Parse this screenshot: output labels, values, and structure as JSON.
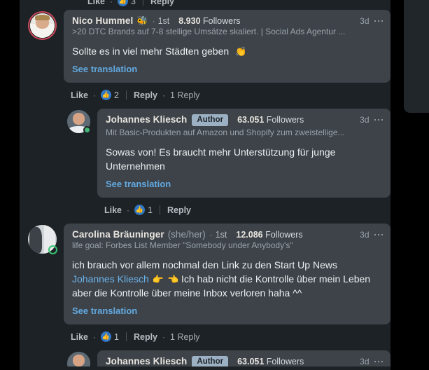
{
  "window": {
    "background": "#1d2226",
    "bubble_color": "#3d4349",
    "link_color": "#63a9e0",
    "accent_badge_color": "#9cb0c4"
  },
  "partial_top_actions": {
    "like_label": "Like",
    "separator": "·",
    "reaction_count": "3",
    "reply_label": "Reply"
  },
  "comments": [
    {
      "id": "comment-nico-hummel",
      "author": "Nico Hummel",
      "name_emoji": "🐝",
      "degree_dot": "·",
      "degree": "1st",
      "followers_count": "8.930",
      "followers_label": "Followers",
      "headline": ">20 DTC Brands auf 7-8 stellige Umsätze skaliert. | Social Ads Agentur ...",
      "timestamp": "3d",
      "body": "Sollte es in viel mehr Städten geben ",
      "body_emoji": "👏",
      "see_translation": "See translation",
      "actions": {
        "like_label": "Like",
        "separator": "·",
        "reaction_count": "2",
        "reply_label": "Reply",
        "reply_count": "1 Reply"
      }
    },
    {
      "id": "comment-johannes-kliesch-reply",
      "author": "Johannes Kliesch",
      "badge": "Author",
      "followers_count": "63.051",
      "followers_label": "Followers",
      "headline": "Mit Basic-Produkten auf Amazon und Shopify zum zweistellige...",
      "timestamp": "3d",
      "body": "Sowas von! Es braucht mehr Unterstützung für junge Unternehmen",
      "see_translation": "See translation",
      "actions": {
        "like_label": "Like",
        "separator": "·",
        "reaction_count": "1",
        "reply_label": "Reply"
      }
    },
    {
      "id": "comment-carolina-brauninger",
      "author": "Carolina Bräuninger",
      "pronouns": "(she/her)",
      "degree_dot": "·",
      "degree": "1st",
      "followers_count": "12.086",
      "followers_label": "Followers",
      "headline": "life goal: Forbes List Member \"Somebody under Anybody's\"",
      "timestamp": "3d",
      "body_line_1": "ich brauch vor allem nochmal den Link zu den Start Up News ",
      "mention": "Johannes Kliesch",
      "body_emoji_1": "👉",
      "body_emoji_2": "👈",
      "body_line_2": " Ich hab nicht die Kontrolle über mein Leben aber die Kontrolle über meine Inbox verloren haha ^^",
      "see_translation": "See translation",
      "actions": {
        "like_label": "Like",
        "separator": "·",
        "reaction_count": "1",
        "reply_label": "Reply",
        "reply_count": "1 Reply"
      }
    }
  ],
  "partial_bottom_comment": {
    "author": "Johannes Kliesch",
    "badge": "Author",
    "followers_count": "63.051",
    "followers_label": "Followers",
    "timestamp": "3d"
  }
}
